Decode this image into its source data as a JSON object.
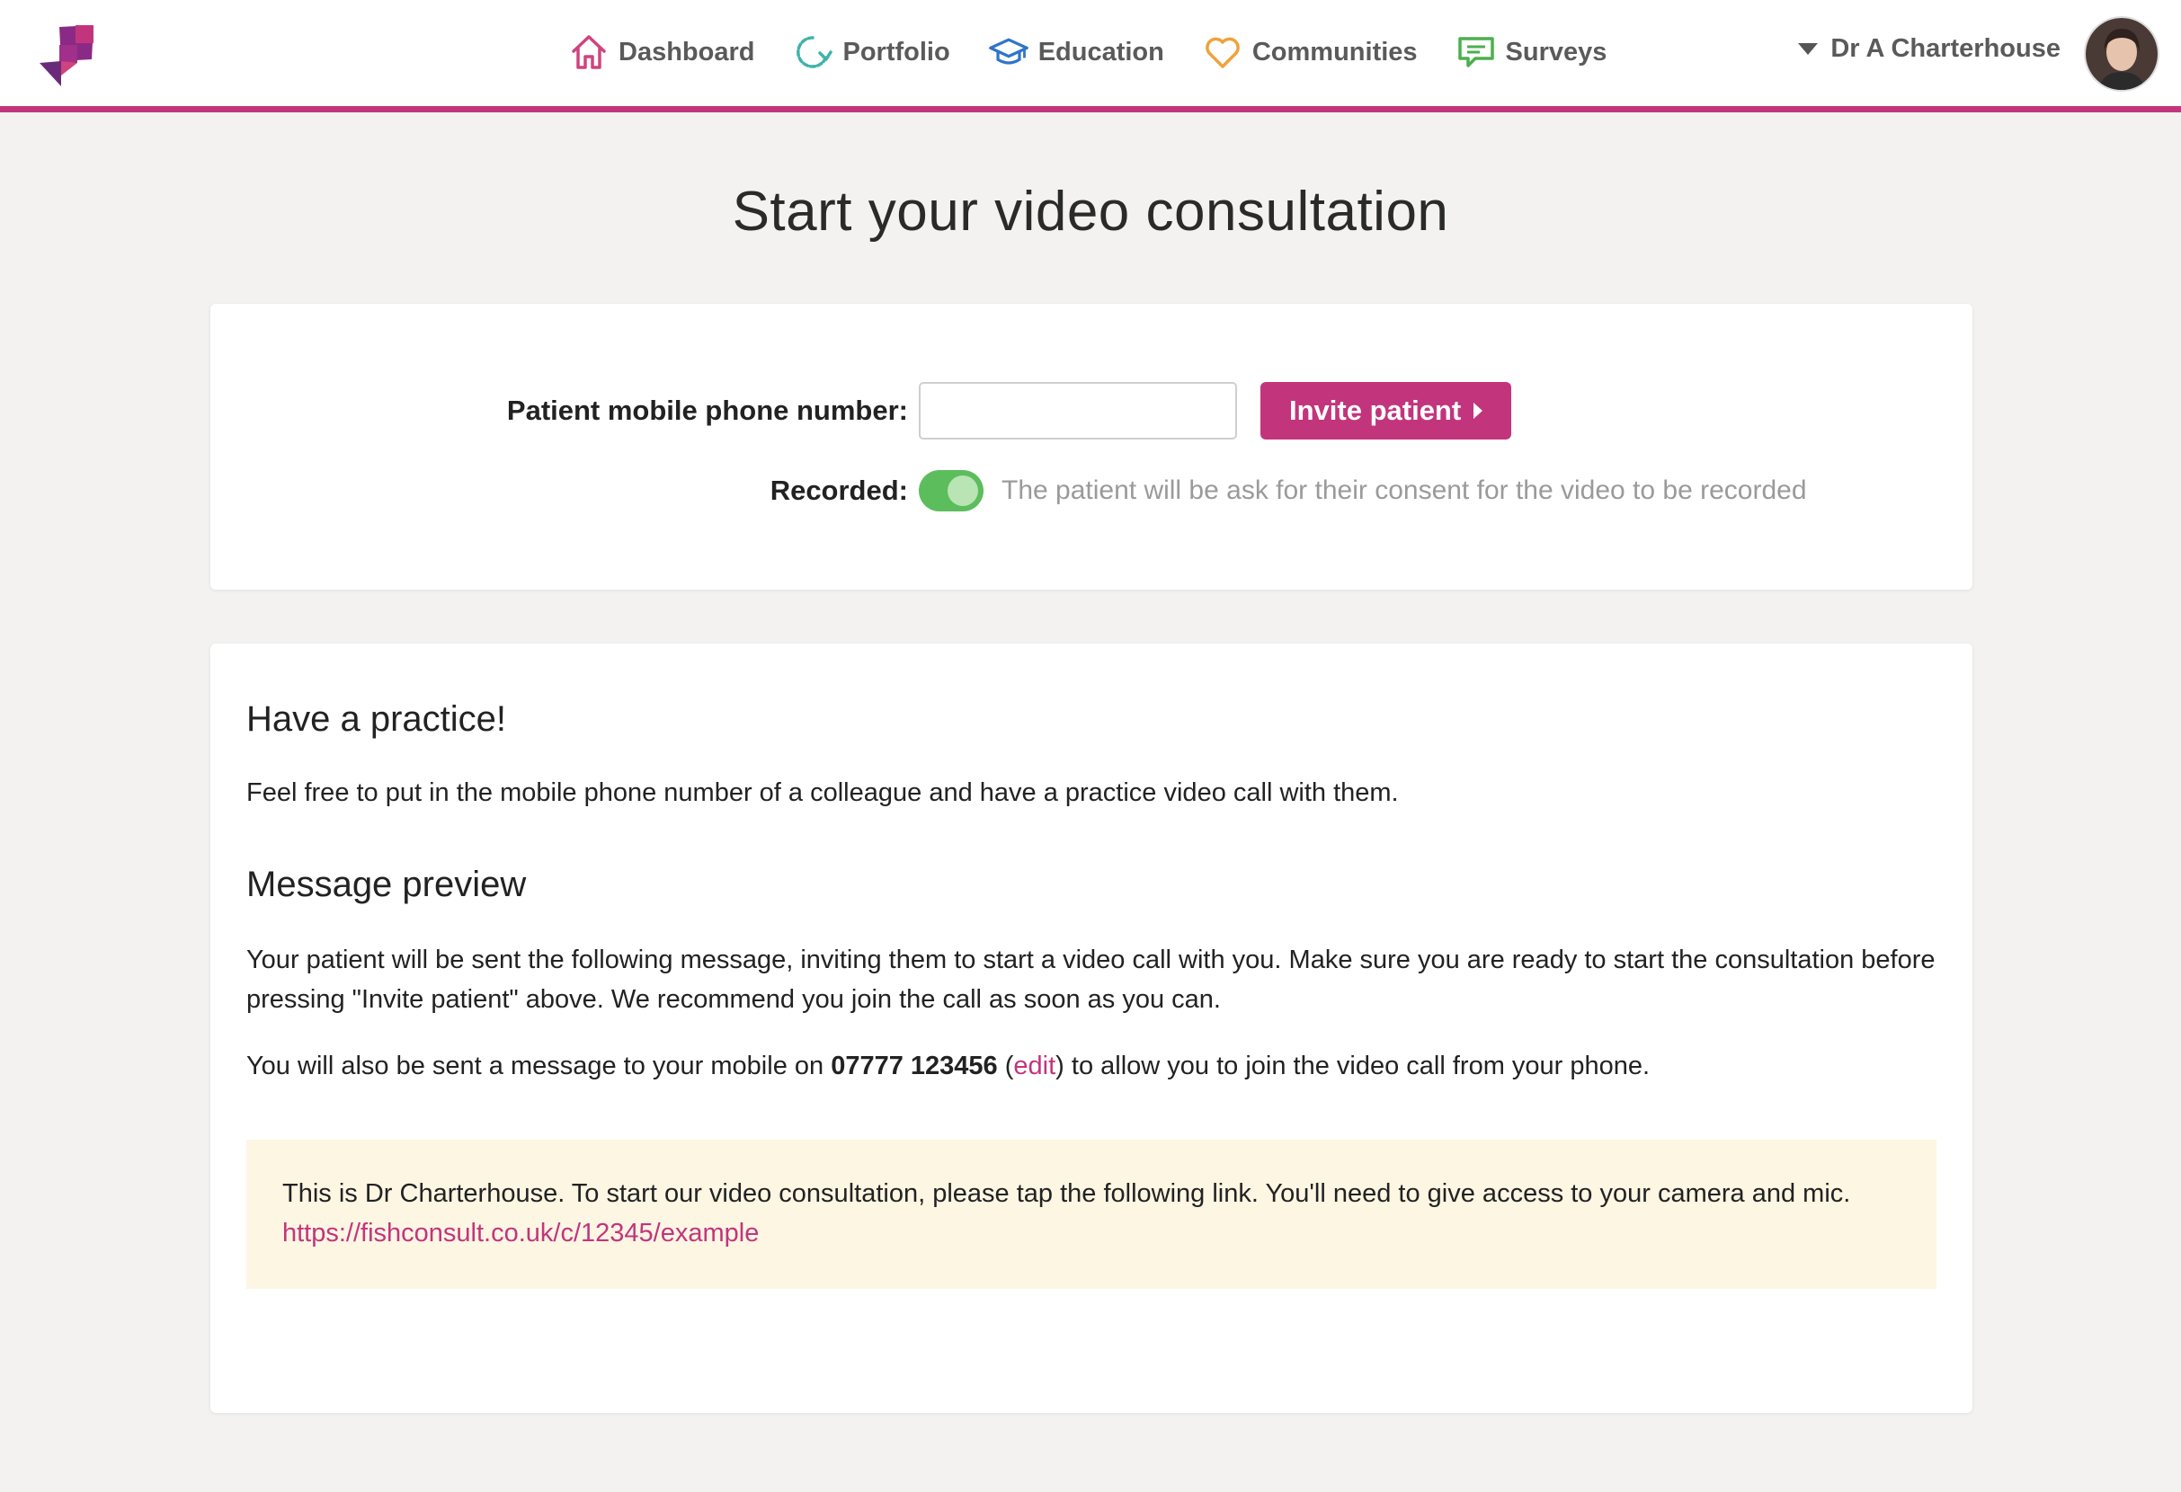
{
  "header": {
    "nav": [
      {
        "label": "Dashboard",
        "icon": "home-icon",
        "color": "#d0437e"
      },
      {
        "label": "Portfolio",
        "icon": "refresh-icon",
        "color": "#3fb3a8"
      },
      {
        "label": "Education",
        "icon": "graduation-cap-icon",
        "color": "#2f74c9"
      },
      {
        "label": "Communities",
        "icon": "heart-icon",
        "color": "#f0a23b"
      },
      {
        "label": "Surveys",
        "icon": "chat-bubble-icon",
        "color": "#4bb04e"
      }
    ],
    "user_name": "Dr A Charterhouse"
  },
  "page": {
    "title": "Start your video consultation"
  },
  "invite_form": {
    "phone_label": "Patient mobile phone number:",
    "phone_value": "",
    "invite_button": "Invite patient",
    "recorded_label": "Recorded:",
    "recorded_on": true,
    "recorded_hint": "The patient will be ask for their consent for the video to be recorded"
  },
  "practice": {
    "heading": "Have a practice!",
    "text": "Feel free to put in the mobile phone number of a colleague and have a practice video call with them."
  },
  "preview": {
    "heading": "Message preview",
    "intro": "Your patient will be sent the following message, inviting them to start a video call with you. Make sure you are ready to start the consultation before pressing \"Invite patient\" above. We recommend you join the call as soon as you can.",
    "mobile_prefix": "You will also be sent a message to your mobile on ",
    "mobile_number": "07777 123456",
    "edit_open": " (",
    "edit_link": "edit",
    "mobile_suffix": ") to allow you to join the video call from your phone.",
    "message_text": "This is Dr Charterhouse. To start our video consultation, please tap the following link. You'll need to give access to your camera and mic.",
    "message_link": "https://fishconsult.co.uk/c/12345/example"
  },
  "colors": {
    "accent": "#c2357d",
    "toggle_on": "#5cbd5c",
    "message_bg": "#fdf6e3"
  }
}
